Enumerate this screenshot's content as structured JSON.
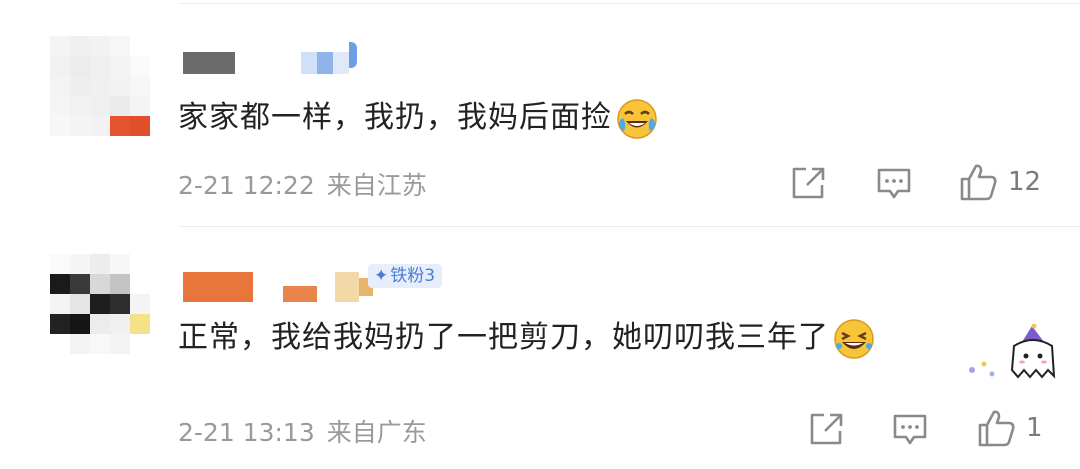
{
  "comments": [
    {
      "id": "c1",
      "text": "家家都一样，我扔，我妈后面捡",
      "emoji": "crying-laughing",
      "time": "2-21 12:22",
      "location": "来自江苏",
      "likes": "12"
    },
    {
      "id": "c2",
      "badge": "铁粉3",
      "text": "正常，我给我妈扔了一把剪刀，她叨叨我三年了",
      "emoji": "laughing",
      "time": "2-21 13:13",
      "location": "来自广东",
      "likes": "1"
    }
  ],
  "icons": {
    "share": "share-icon",
    "reply": "comment-icon",
    "like": "thumbs-up-icon"
  },
  "colors": {
    "text": "#222222",
    "meta": "#9a9a9a",
    "badge_bg": "#e6eefb",
    "badge_text": "#4a7fd4",
    "second_comment_highlight": "#f3f1fb"
  }
}
